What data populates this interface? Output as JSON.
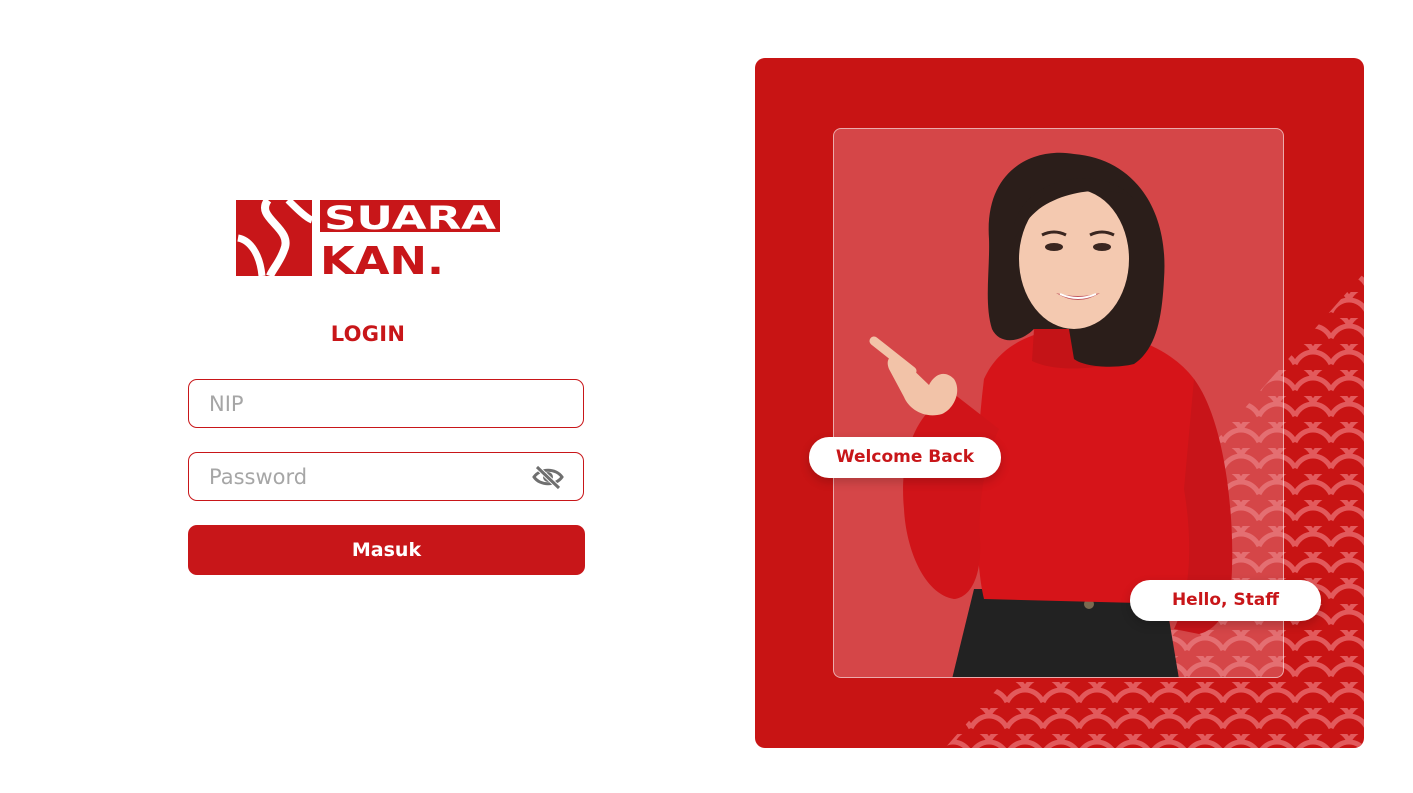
{
  "brand": {
    "logo_line1": "SUARA",
    "logo_line2": "KAN.",
    "color": "#c81619"
  },
  "login": {
    "title": "LOGIN",
    "nip_placeholder": "NIP",
    "password_placeholder": "Password",
    "password_toggle_icon": "eye-slash-icon",
    "submit_label": "Masuk"
  },
  "hero": {
    "welcome_label": "Welcome Back",
    "hello_label": "Hello, Staff",
    "background_color": "#c81414"
  }
}
